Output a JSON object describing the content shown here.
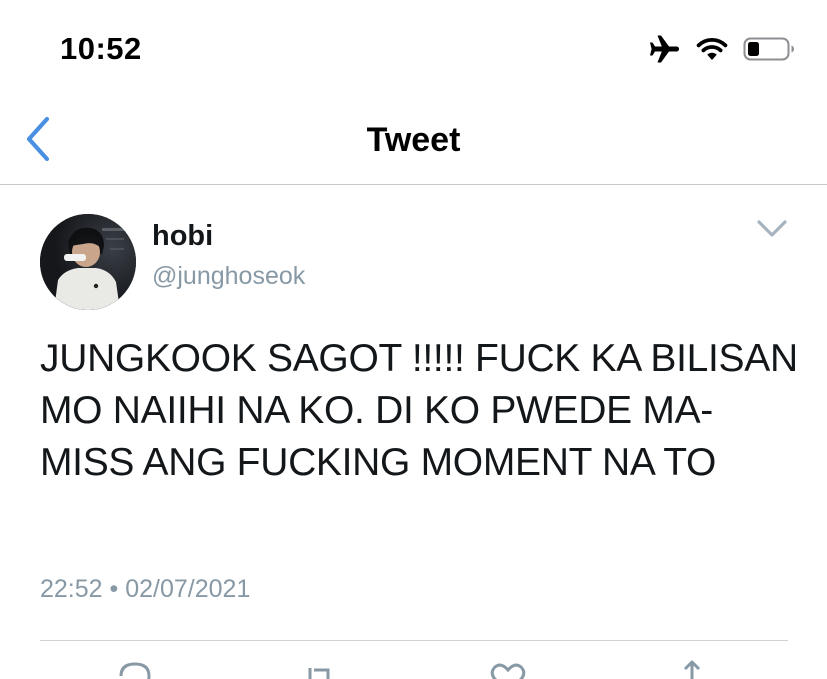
{
  "status_bar": {
    "time": "10:52",
    "icons": [
      "airplane-icon",
      "wifi-icon",
      "battery-icon"
    ]
  },
  "nav": {
    "back_icon": "chevron-left-icon",
    "title": "Tweet"
  },
  "tweet": {
    "author": {
      "display_name": "hobi",
      "handle": "@junghoseok"
    },
    "menu_icon": "chevron-down-icon",
    "text": "JUNGKOOK SAGOT !!!!! FUCK KA BILISAN MO NAIIHI NA KO. DI KO PWEDE MA-MISS ANG FUCKING MOMENT NA TO",
    "time": "22:52",
    "separator": "•",
    "date": "02/07/2021"
  },
  "actions": [
    "reply-icon",
    "retweet-icon",
    "like-icon",
    "share-icon"
  ],
  "colors": {
    "accent": "#4a90e2",
    "secondary_text": "#8899a6",
    "primary_text": "#14171a",
    "divider": "#d0d3d6"
  }
}
